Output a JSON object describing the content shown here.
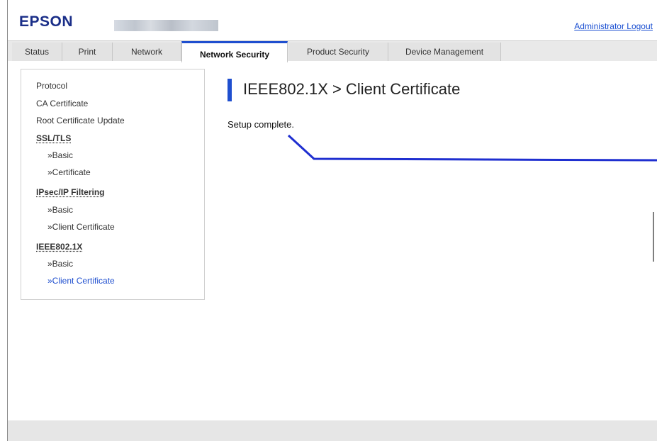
{
  "header": {
    "logo": "EPSON",
    "admin_logout": "Administrator Logout"
  },
  "tabs": [
    {
      "label": "Status",
      "active": false
    },
    {
      "label": "Print",
      "active": false
    },
    {
      "label": "Network",
      "active": false
    },
    {
      "label": "Network Security",
      "active": true
    },
    {
      "label": "Product Security",
      "active": false
    },
    {
      "label": "Device Management",
      "active": false
    }
  ],
  "sidebar": {
    "items": [
      {
        "label": "Protocol"
      },
      {
        "label": "CA Certificate"
      },
      {
        "label": "Root Certificate Update"
      },
      {
        "label": "SSL/TLS"
      },
      {
        "label": "»Basic"
      },
      {
        "label": "»Certificate"
      },
      {
        "label": "IPsec/IP Filtering"
      },
      {
        "label": "»Basic"
      },
      {
        "label": "»Client Certificate"
      },
      {
        "label": "IEEE802.1X"
      },
      {
        "label": "»Basic"
      },
      {
        "label": "»Client Certificate"
      }
    ]
  },
  "main": {
    "title": "IEEE802.1X > Client Certificate",
    "message": "Setup complete."
  },
  "colors": {
    "brand": "#1a2e88",
    "accent": "#1f4fcf",
    "link": "#1a4fd1"
  }
}
